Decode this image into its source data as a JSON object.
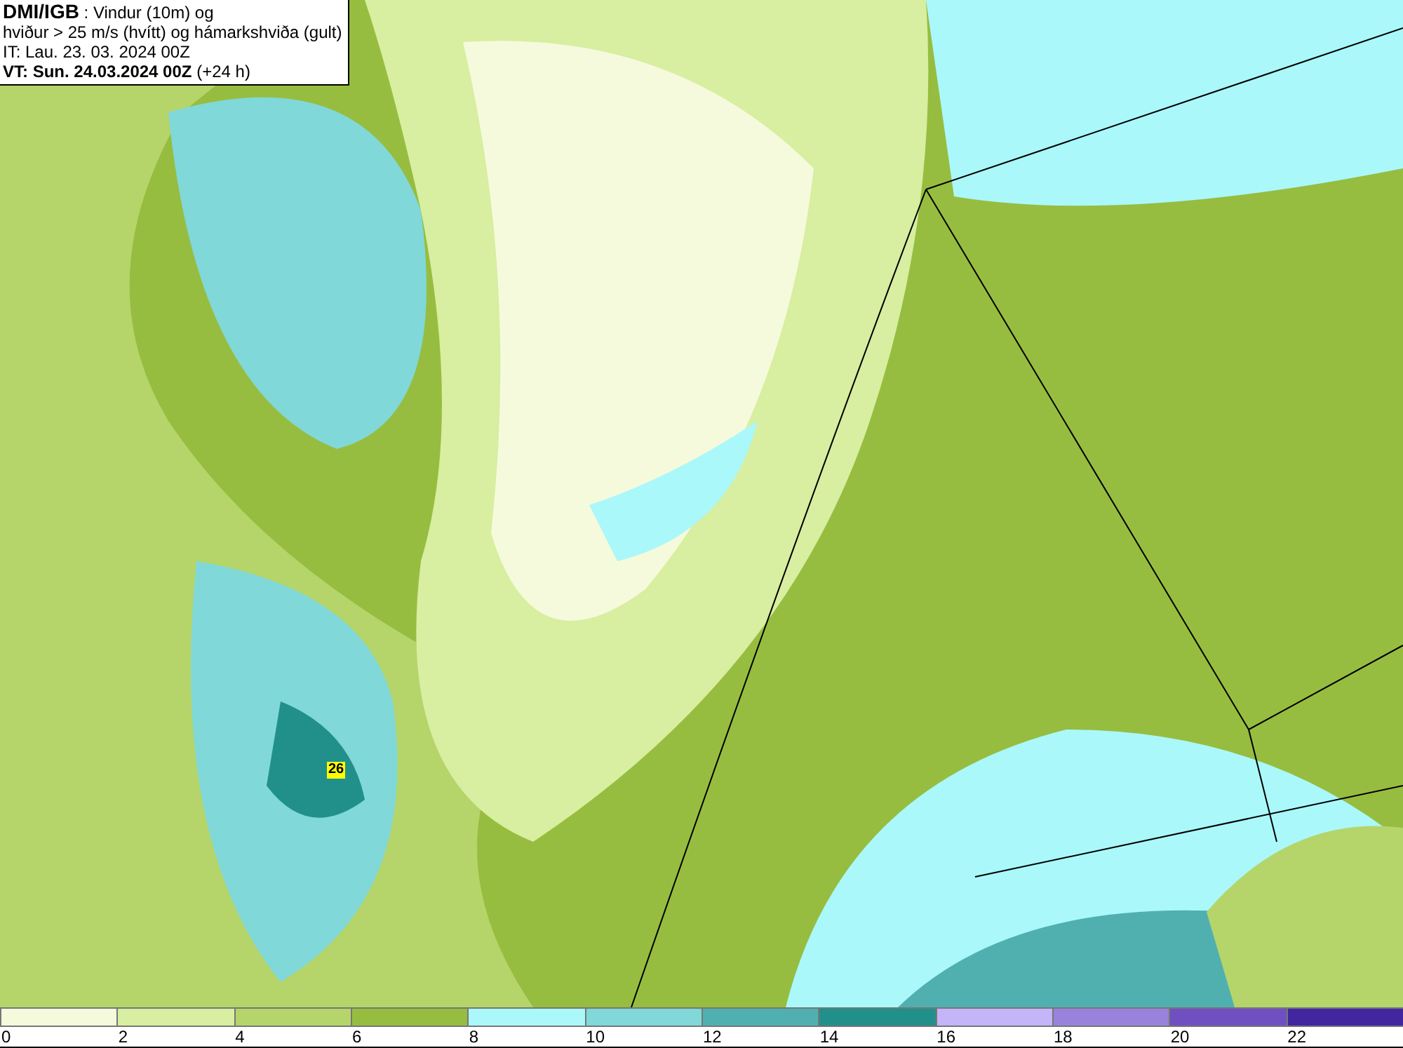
{
  "header": {
    "line1": "**DMI/IGB** : Vindur (10m) og",
    "line2": "hviður > 25 m/s (hvítt) og hámarkshviða (gult)",
    "line3": "IT: Lau. 23. 03. 2024 00Z",
    "line4": "**VT: Sun. 24.03.2024 00Z** (+24 h)"
  },
  "map": {
    "gust_label": "26"
  },
  "legend": [
    {
      "label": "0",
      "color": "#f5fadc"
    },
    {
      "label": "2",
      "color": "#d8eea0"
    },
    {
      "label": "4",
      "color": "#b5d56a"
    },
    {
      "label": "6",
      "color": "#97bd40"
    },
    {
      "label": "8",
      "color": "#aaf8fa"
    },
    {
      "label": "10",
      "color": "#80d8d8"
    },
    {
      "label": "12",
      "color": "#50b0b0"
    },
    {
      "label": "14",
      "color": "#22908a"
    },
    {
      "label": "16",
      "color": "#c4b4f8"
    },
    {
      "label": "18",
      "color": "#9882dc"
    },
    {
      "label": "20",
      "color": "#7050c0"
    },
    {
      "label": "22",
      "color": "#4226a0"
    }
  ]
}
